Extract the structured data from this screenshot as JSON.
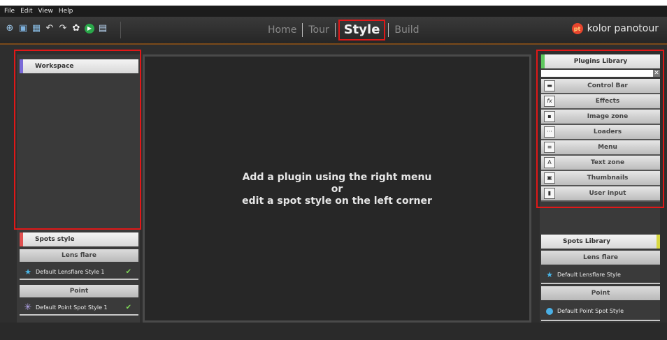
{
  "menu": [
    "File",
    "Edit",
    "View",
    "Help"
  ],
  "toolbar_icons": [
    "new-tour-icon",
    "save-icon",
    "add-panorama-icon",
    "undo-icon",
    "redo-icon",
    "settings-icon",
    "play-icon",
    "publish-icon"
  ],
  "nav": {
    "home": "Home",
    "tour": "Tour",
    "style": "Style",
    "build": "Build"
  },
  "brand": {
    "logo_text": "pt",
    "name": "kolor panotour"
  },
  "left": {
    "workspace": "Workspace",
    "spots_style": "Spots style",
    "lens_flare": "Lens flare",
    "lens_flare_item": "Default Lensflare Style 1",
    "point": "Point",
    "point_item": "Default Point Spot Style 1"
  },
  "canvas": {
    "line1": "Add a plugin using the right menu",
    "line2": "or",
    "line3": "edit a spot style on the left corner"
  },
  "right": {
    "plugins_library": "Plugins Library",
    "plugins": [
      {
        "label": "Control Bar",
        "icon": "control-bar-icon",
        "glyph": "▬"
      },
      {
        "label": "Effects",
        "icon": "effects-icon",
        "glyph": "fx"
      },
      {
        "label": "Image zone",
        "icon": "image-zone-icon",
        "glyph": "▪"
      },
      {
        "label": "Loaders",
        "icon": "loaders-icon",
        "glyph": "···"
      },
      {
        "label": "Menu",
        "icon": "menu-icon",
        "glyph": "≡"
      },
      {
        "label": "Text zone",
        "icon": "text-zone-icon",
        "glyph": "A"
      },
      {
        "label": "Thumbnails",
        "icon": "thumbnails-icon",
        "glyph": "▣"
      },
      {
        "label": "User input",
        "icon": "user-input-icon",
        "glyph": "▮"
      }
    ],
    "spots_library": "Spots Library",
    "lens_flare": "Lens flare",
    "lens_flare_item": "Default Lensflare Style",
    "point": "Point",
    "point_item": "Default Point Spot Style"
  },
  "colors": {
    "highlight": "#e01818",
    "workspace_stripe": "#7a6ad8",
    "spots_stripe": "#e05050",
    "plugins_stripe": "#5ec85e",
    "spots_lib_stripe": "#d8d840"
  }
}
